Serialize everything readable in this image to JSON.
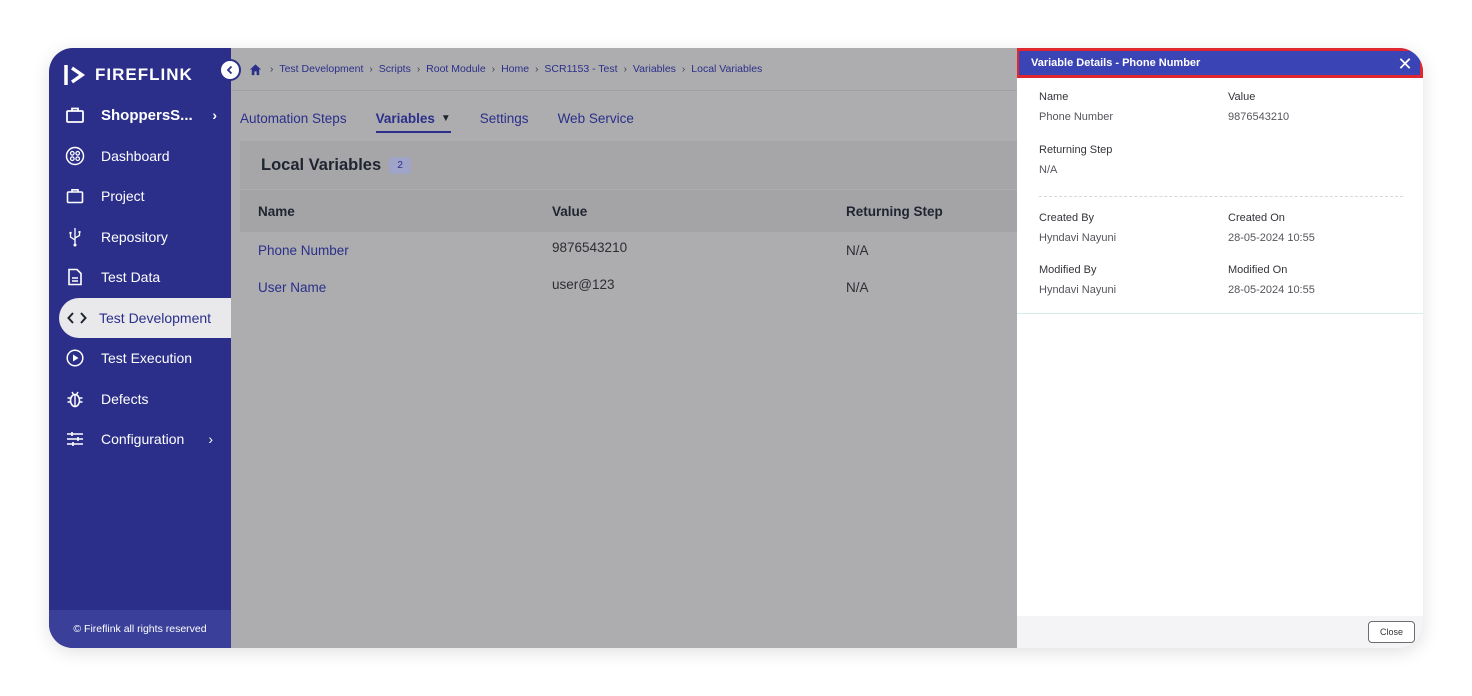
{
  "sidebar": {
    "logo_text": "FIREFLINK",
    "project": "ShoppersS...",
    "items": [
      {
        "label": "Dashboard",
        "icon": "dashboard-icon"
      },
      {
        "label": "Project",
        "icon": "briefcase-icon"
      },
      {
        "label": "Repository",
        "icon": "usb-icon"
      },
      {
        "label": "Test Data",
        "icon": "file-icon"
      },
      {
        "label": "Test Development",
        "icon": "code-icon"
      },
      {
        "label": "Test Execution",
        "icon": "play-circle-icon"
      },
      {
        "label": "Defects",
        "icon": "bug-icon"
      },
      {
        "label": "Configuration",
        "icon": "sliders-icon"
      }
    ],
    "footer": "© Fireflink all rights reserved"
  },
  "breadcrumb": [
    "Test Development",
    "Scripts",
    "Root Module",
    "Home",
    "SCR1153 - Test",
    "Variables",
    "Local Variables"
  ],
  "tabs": [
    "Automation Steps",
    "Variables",
    "Settings",
    "Web Service"
  ],
  "section": {
    "title": "Local Variables",
    "count": "2"
  },
  "table": {
    "headers": [
      "Name",
      "Value",
      "Returning Step"
    ],
    "rows": [
      {
        "name": "Phone Number",
        "value": "9876543210",
        "step": "N/A"
      },
      {
        "name": "User Name",
        "value": "user@123",
        "step": "N/A"
      }
    ]
  },
  "panel": {
    "title": "Variable Details - Phone Number",
    "name_label": "Name",
    "name_value": "Phone Number",
    "value_label": "Value",
    "value_value": "9876543210",
    "returning_label": "Returning Step",
    "returning_value": "N/A",
    "created_by_label": "Created By",
    "created_by_value": "Hyndavi Nayuni",
    "created_on_label": "Created On",
    "created_on_value": "28-05-2024 10:55",
    "modified_by_label": "Modified By",
    "modified_by_value": "Hyndavi Nayuni",
    "modified_on_label": "Modified On",
    "modified_on_value": "28-05-2024 10:55",
    "close_label": "Close"
  },
  "colors": {
    "sidebar": "#2b2f8a",
    "accent": "#3a44b5",
    "highlight": "#e0262f"
  }
}
